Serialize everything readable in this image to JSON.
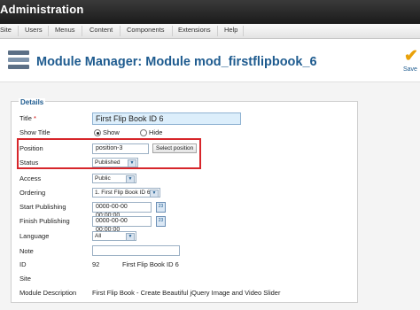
{
  "header": {
    "title": "Administration"
  },
  "menu": {
    "items": [
      "Site",
      "Users",
      "Menus",
      "Content",
      "Components",
      "Extensions",
      "Help"
    ]
  },
  "toolbar": {
    "page_title": "Module Manager: Module mod_firstflipbook_6",
    "save_label": "Save"
  },
  "details": {
    "legend": "Details",
    "title_label": "Title",
    "required_mark": "*",
    "title_value": "First Flip Book ID 6",
    "show_title_label": "Show Title",
    "show_option": "Show",
    "hide_option": "Hide",
    "position_label": "Position",
    "position_value": "position-3",
    "select_position_button": "Select position",
    "status_label": "Status",
    "status_value": "Published",
    "access_label": "Access",
    "access_value": "Public",
    "ordering_label": "Ordering",
    "ordering_value": "1. First Flip Book ID 6",
    "start_publishing_label": "Start Publishing",
    "start_publishing_value": "0000-00-00 00:00:00",
    "finish_publishing_label": "Finish Publishing",
    "finish_publishing_value": "0000-00-00 00:00:00",
    "calendar_text": "23",
    "language_label": "Language",
    "language_value": "All",
    "note_label": "Note",
    "note_value": "",
    "id_label": "ID",
    "id_value": "92",
    "id_name": "First Flip Book ID 6",
    "site_label": "Site",
    "module_description_label": "Module Description",
    "module_description_value": "First Flip Book - Create Beautiful jQuery Image and Video Slider"
  },
  "colors": {
    "accent": "#1e5b8f",
    "highlight_border": "#d7262b",
    "save_icon": "#e9a10a"
  }
}
